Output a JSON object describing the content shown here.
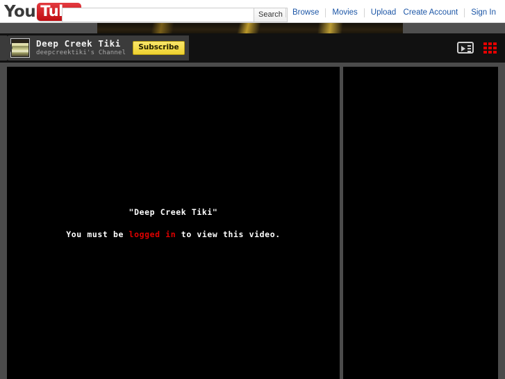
{
  "masthead": {
    "logo": {
      "you": "You",
      "tube": "Tube"
    },
    "search": {
      "value": "",
      "placeholder": "",
      "button_label": "Search"
    },
    "nav_left": [
      {
        "label": "Browse"
      },
      {
        "label": "Movies"
      },
      {
        "label": "Upload"
      }
    ],
    "nav_right": [
      {
        "label": "Create Account"
      },
      {
        "label": "Sign In"
      }
    ]
  },
  "channel": {
    "title": "Deep Creek Tiki",
    "subtitle": "deepcreektiki's Channel",
    "subscribe_label": "Subscribe",
    "avatar_name": "channel-thumbnail",
    "view_icons": [
      {
        "name": "player-view-icon",
        "color": "#cfcfcf"
      },
      {
        "name": "grid-view-icon",
        "color": "#e50000"
      }
    ]
  },
  "video": {
    "quoted_title": "\"Deep Creek Tiki\"",
    "message_prefix": "You must be ",
    "message_link": "logged in",
    "message_suffix": " to view this video.",
    "link_color": "#e00000"
  },
  "theme": {
    "page_background": "#4b4b4b",
    "panel_background": "#000000",
    "channel_bar_background": "#111111",
    "channel_plate_background": "#3b3b3b",
    "subscribe_background": "#f7e04f",
    "link_blue": "#1b55a6",
    "logo_red": "#cc181e"
  }
}
